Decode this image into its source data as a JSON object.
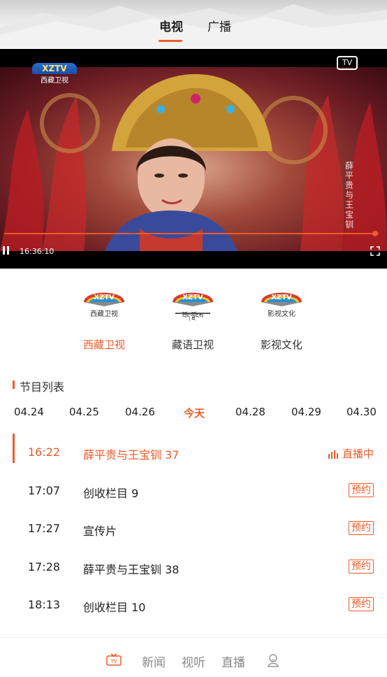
{
  "header": {
    "tabs": [
      {
        "label": "电视",
        "active": true
      },
      {
        "label": "广播",
        "active": false
      }
    ]
  },
  "player": {
    "channel_logo_text": "XZTV",
    "channel_logo_sub": "西藏卫视",
    "tv_badge": "TV",
    "side_caption": "薛平贵与王宝钏",
    "current_time": "16:36:10",
    "progress": 0.99
  },
  "channels": [
    {
      "name": "西藏卫视",
      "logo_label": "西藏卫视",
      "active": true
    },
    {
      "name": "藏语卫视",
      "logo_label": "བོད་ལྗོངས",
      "active": false
    },
    {
      "name": "影视文化",
      "logo_label": "影视文化",
      "active": false
    }
  ],
  "schedule": {
    "title": "节目列表",
    "dates": [
      "04.24",
      "04.25",
      "04.26",
      "今天",
      "04.28",
      "04.29",
      "04.30"
    ],
    "today_index": 3,
    "programs": [
      {
        "time": "16:22",
        "title": "薛平贵与王宝钏 37",
        "status": "直播中",
        "live": true
      },
      {
        "time": "17:07",
        "title": "创收栏目 9",
        "status": "预约",
        "live": false
      },
      {
        "time": "17:27",
        "title": "宣传片",
        "status": "预约",
        "live": false
      },
      {
        "time": "17:28",
        "title": "薛平贵与王宝钏 38",
        "status": "预约",
        "live": false
      },
      {
        "time": "18:13",
        "title": "创收栏目 10",
        "status": "预约",
        "live": false
      }
    ]
  },
  "bottom_nav": {
    "items": [
      {
        "label": "TV",
        "icon": "tv-icon"
      },
      {
        "label": "新闻"
      },
      {
        "label": "视听"
      },
      {
        "label": "直播"
      },
      {
        "label": "",
        "icon": "user-icon"
      }
    ]
  },
  "colors": {
    "accent": "#f05a28"
  }
}
